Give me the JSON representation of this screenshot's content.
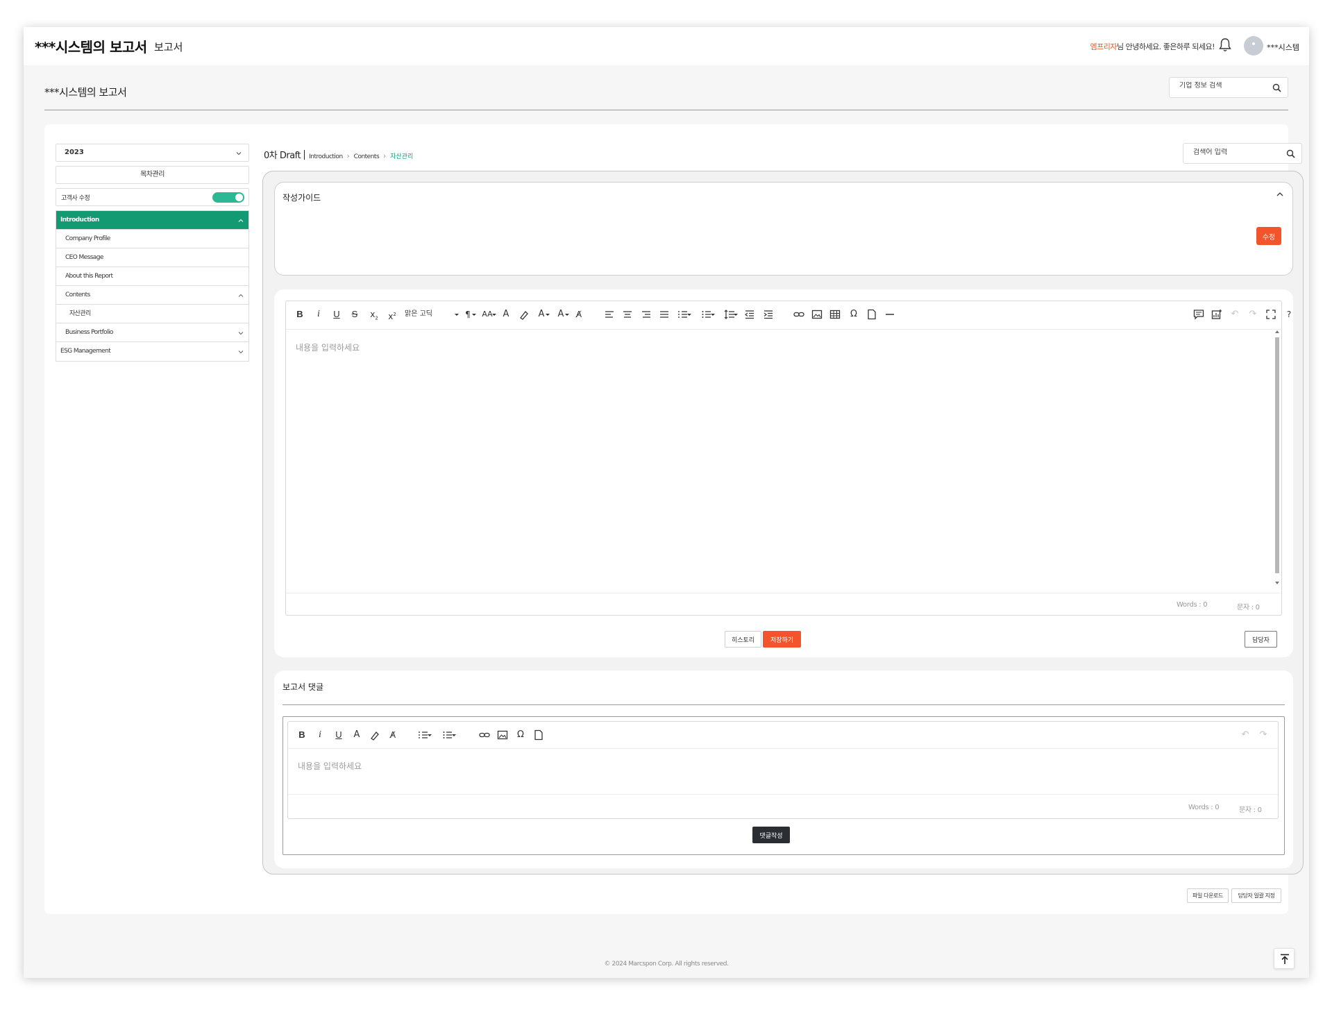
{
  "header": {
    "brand": "***시스템의 보고서",
    "brand_sub": "보고서",
    "greeting_name": "엠프리자",
    "greeting_text": "님 안녕하세요. 좋은하루 되세요!",
    "user_name": "***시스템"
  },
  "page": {
    "title": "***시스템의 보고서",
    "corp_search_placeholder": "기업 정보 검색"
  },
  "sidebar": {
    "year": "2023",
    "toc_button": "목차관리",
    "client_edit_label": "고객사 수정",
    "client_edit_on": true,
    "items": [
      {
        "label": "Introduction",
        "state": "active-expanded"
      },
      {
        "label": "Company Profile"
      },
      {
        "label": "CEO Message"
      },
      {
        "label": "About this Report"
      },
      {
        "label": "Contents",
        "state": "expanded"
      },
      {
        "label": "자산관리"
      },
      {
        "label": "Business Portfolio",
        "state": "collapsed"
      },
      {
        "label": "ESG Management",
        "state": "collapsed"
      }
    ]
  },
  "breadcrumb": {
    "draft": "0차 Draft",
    "items": [
      "Introduction",
      "Contents"
    ],
    "current": "자산관리"
  },
  "keyword_search_placeholder": "검색어 입력",
  "guide": {
    "title": "작성가이드",
    "edit_label": "수정"
  },
  "editor": {
    "font_name": "맑은 고딕",
    "placeholder": "내용을 입력하세요",
    "words": "Words : 0",
    "chars": "문자 : 0"
  },
  "actions": {
    "history": "히스토리",
    "save": "저장하기",
    "assignee": "담당자"
  },
  "comments": {
    "title": "보고서 댓글",
    "placeholder": "내용을 입력하세요",
    "words": "Words : 0",
    "chars": "문자 : 0",
    "submit": "댓글작성"
  },
  "bottom_actions": {
    "file_download": "파일 다운로드",
    "bulk_assign": "담당자 일괄 지정"
  },
  "footer": "© 2024 Marcspon Corp. All rights reserved.",
  "colors": {
    "accent_green": "#149a73",
    "accent_orange": "#f2552c",
    "dark_button": "#2a2e33"
  }
}
